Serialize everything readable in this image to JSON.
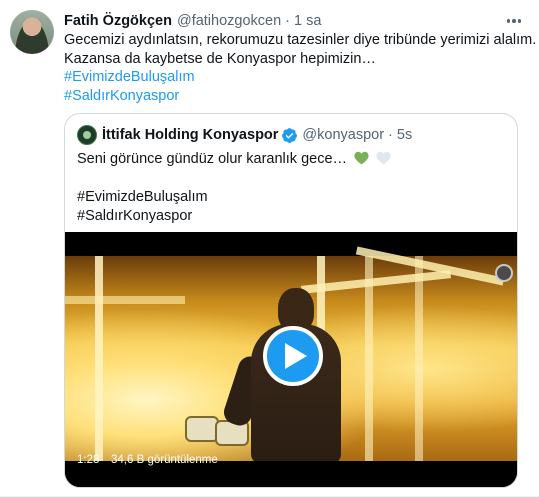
{
  "tweet": {
    "author_name": "Fatih Özgökçen",
    "author_handle": "@fatihozgokcen",
    "separator": "·",
    "time": "1 sa",
    "lines": [
      "Gecemizi aydınlatsın, rekorumuzu tazesinler diye tribünde yerimizi alalım.",
      "Kazansa da kaybetse de Konyaspor hepimizin…"
    ],
    "hashtags": [
      "#EvimizdeBuluşalım",
      "#SaldırKonyaspor"
    ]
  },
  "quote": {
    "author_name": "İttifak Holding Konyaspor",
    "author_handle": "@konyaspor",
    "separator": "·",
    "time": "5s",
    "text": "Seni görünce gündüz olur karanlık gece…",
    "hashtags": [
      "#EvimizdeBuluşalım",
      "#SaldırKonyaspor"
    ],
    "video": {
      "duration": "1:28",
      "views": "34,6 B görüntülenme"
    }
  },
  "colors": {
    "accent": "#1d9bf0",
    "text": "#0f1419",
    "muted": "#536471",
    "green_heart": "#78b159",
    "white_heart": "#e1e8ed"
  }
}
